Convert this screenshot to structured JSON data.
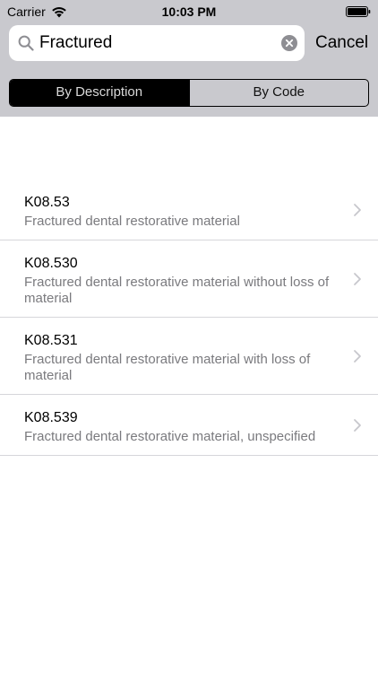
{
  "status_bar": {
    "carrier": "Carrier",
    "time": "10:03 PM",
    "wifi_icon": "wifi-icon",
    "battery_icon": "battery-full-icon"
  },
  "search": {
    "value": "Fractured",
    "cancel_label": "Cancel",
    "search_icon": "magnifier-icon",
    "clear_icon": "clear-circle-icon"
  },
  "segments": {
    "items": [
      {
        "label": "By Description",
        "selected": true
      },
      {
        "label": "By Code",
        "selected": false
      }
    ]
  },
  "results": [
    {
      "code": "K08.53",
      "description": "Fractured dental restorative material"
    },
    {
      "code": "K08.530",
      "description": "Fractured dental restorative material without loss of material"
    },
    {
      "code": "K08.531",
      "description": "Fractured dental restorative material with loss of material"
    },
    {
      "code": "K08.539",
      "description": "Fractured dental restorative material, unspecified"
    }
  ],
  "colors": {
    "header_bg": "#c9c9ce",
    "selected_segment_bg": "#000000",
    "secondary_text": "#7a7a7e"
  }
}
